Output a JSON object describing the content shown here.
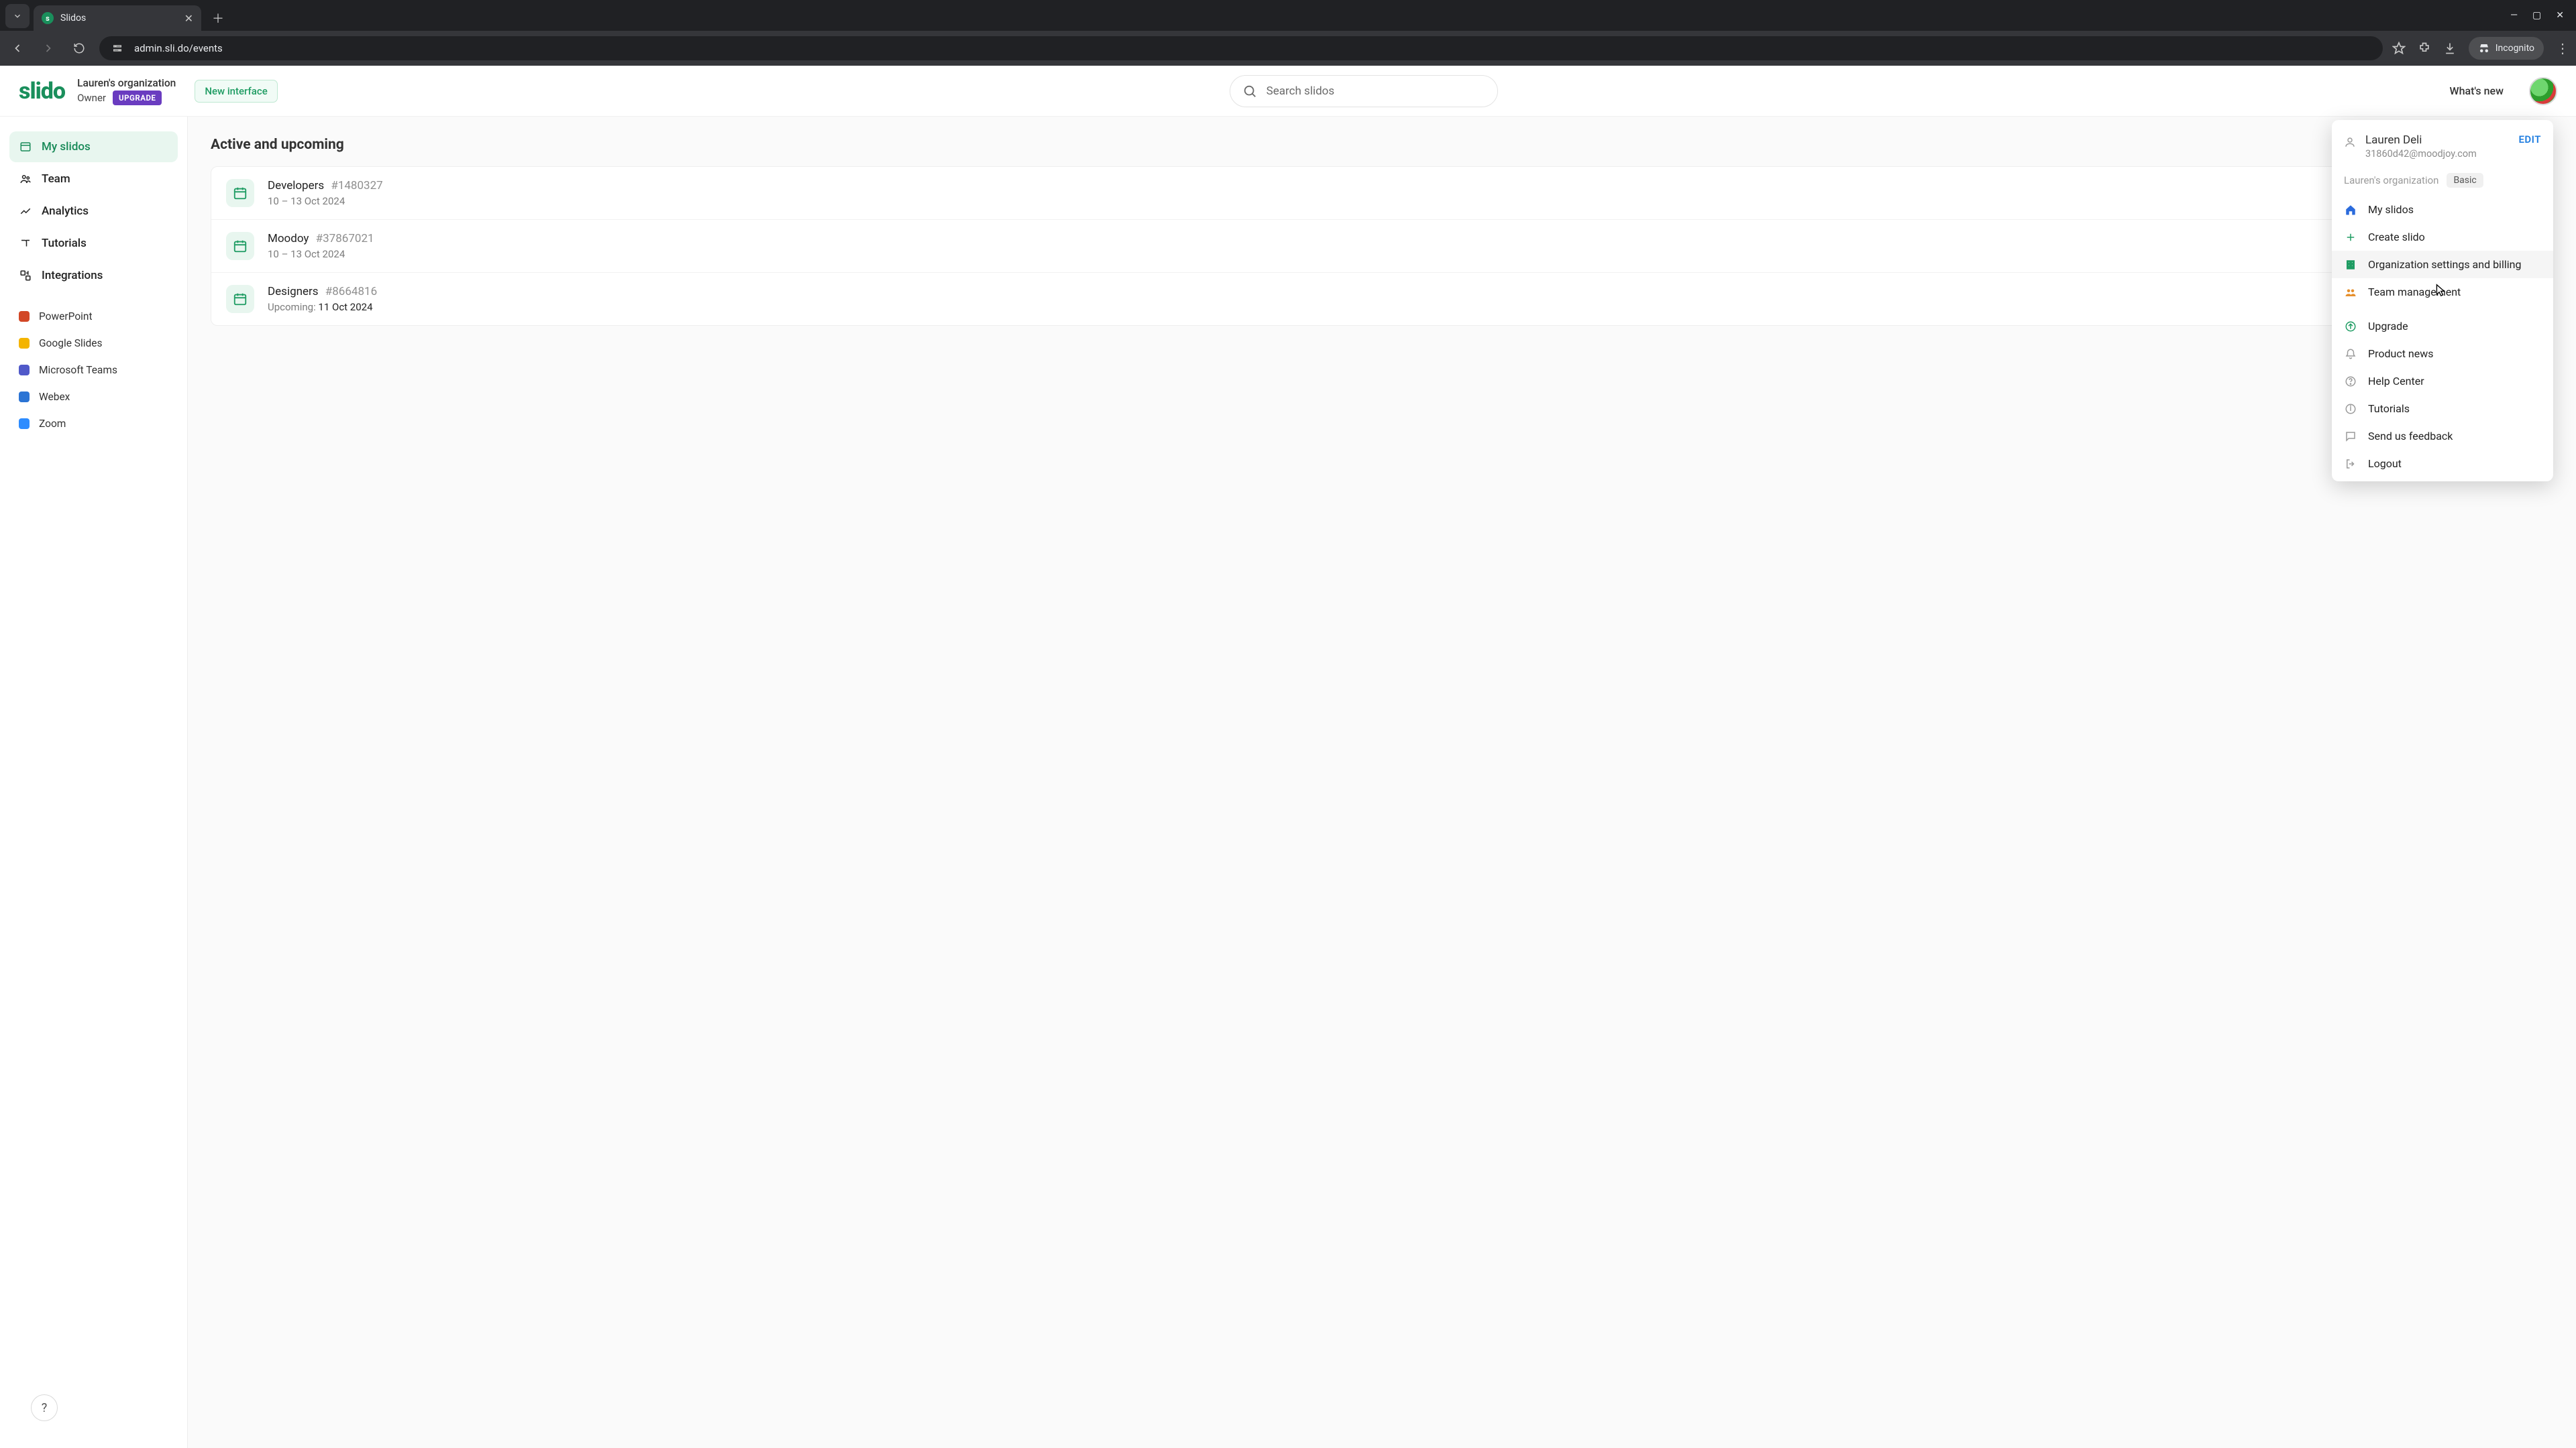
{
  "browser": {
    "tab_title": "Slidos",
    "url": "admin.sli.do/events",
    "incognito_label": "Incognito"
  },
  "header": {
    "logo_text": "slido",
    "org_name": "Lauren's organization",
    "role": "Owner",
    "upgrade_badge": "UPGRADE",
    "new_interface": "New interface",
    "search_placeholder": "Search slidos",
    "whats_new": "What's new"
  },
  "sidebar": {
    "items": [
      {
        "label": "My slidos"
      },
      {
        "label": "Team"
      },
      {
        "label": "Analytics"
      },
      {
        "label": "Tutorials"
      },
      {
        "label": "Integrations"
      }
    ],
    "integrations": [
      {
        "label": "PowerPoint",
        "color": "#d24726"
      },
      {
        "label": "Google Slides",
        "color": "#f4b400"
      },
      {
        "label": "Microsoft Teams",
        "color": "#5059c9"
      },
      {
        "label": "Webex",
        "color": "#2b74d4"
      },
      {
        "label": "Zoom",
        "color": "#2d8cff"
      }
    ],
    "help": "?"
  },
  "main": {
    "section_title": "Active and upcoming",
    "events": [
      {
        "title": "Developers",
        "code": "#1480327",
        "date": "10 – 13 Oct 2024",
        "upcoming": false
      },
      {
        "title": "Moodoy",
        "code": "#37867021",
        "date": "10 – 13 Oct 2024",
        "upcoming": false
      },
      {
        "title": "Designers",
        "code": "#8664816",
        "date": "11 Oct 2024",
        "upcoming": true,
        "upcoming_prefix": "Upcoming: "
      }
    ]
  },
  "user_menu": {
    "name": "Lauren Deli",
    "email": "31860d42@moodjoy.com",
    "edit": "EDIT",
    "org": "Lauren's organization",
    "plan": "Basic",
    "items": [
      {
        "label": "My slidos",
        "kind": "home"
      },
      {
        "label": "Create slido",
        "kind": "create"
      },
      {
        "label": "Organization settings and billing",
        "kind": "org",
        "hover": true
      },
      {
        "label": "Team management",
        "kind": "team"
      }
    ],
    "items2": [
      {
        "label": "Upgrade",
        "kind": "upgrade"
      },
      {
        "label": "Product news",
        "kind": "muted"
      },
      {
        "label": "Help Center",
        "kind": "muted"
      },
      {
        "label": "Tutorials",
        "kind": "muted"
      },
      {
        "label": "Send us feedback",
        "kind": "muted"
      },
      {
        "label": "Logout",
        "kind": "muted"
      }
    ]
  }
}
